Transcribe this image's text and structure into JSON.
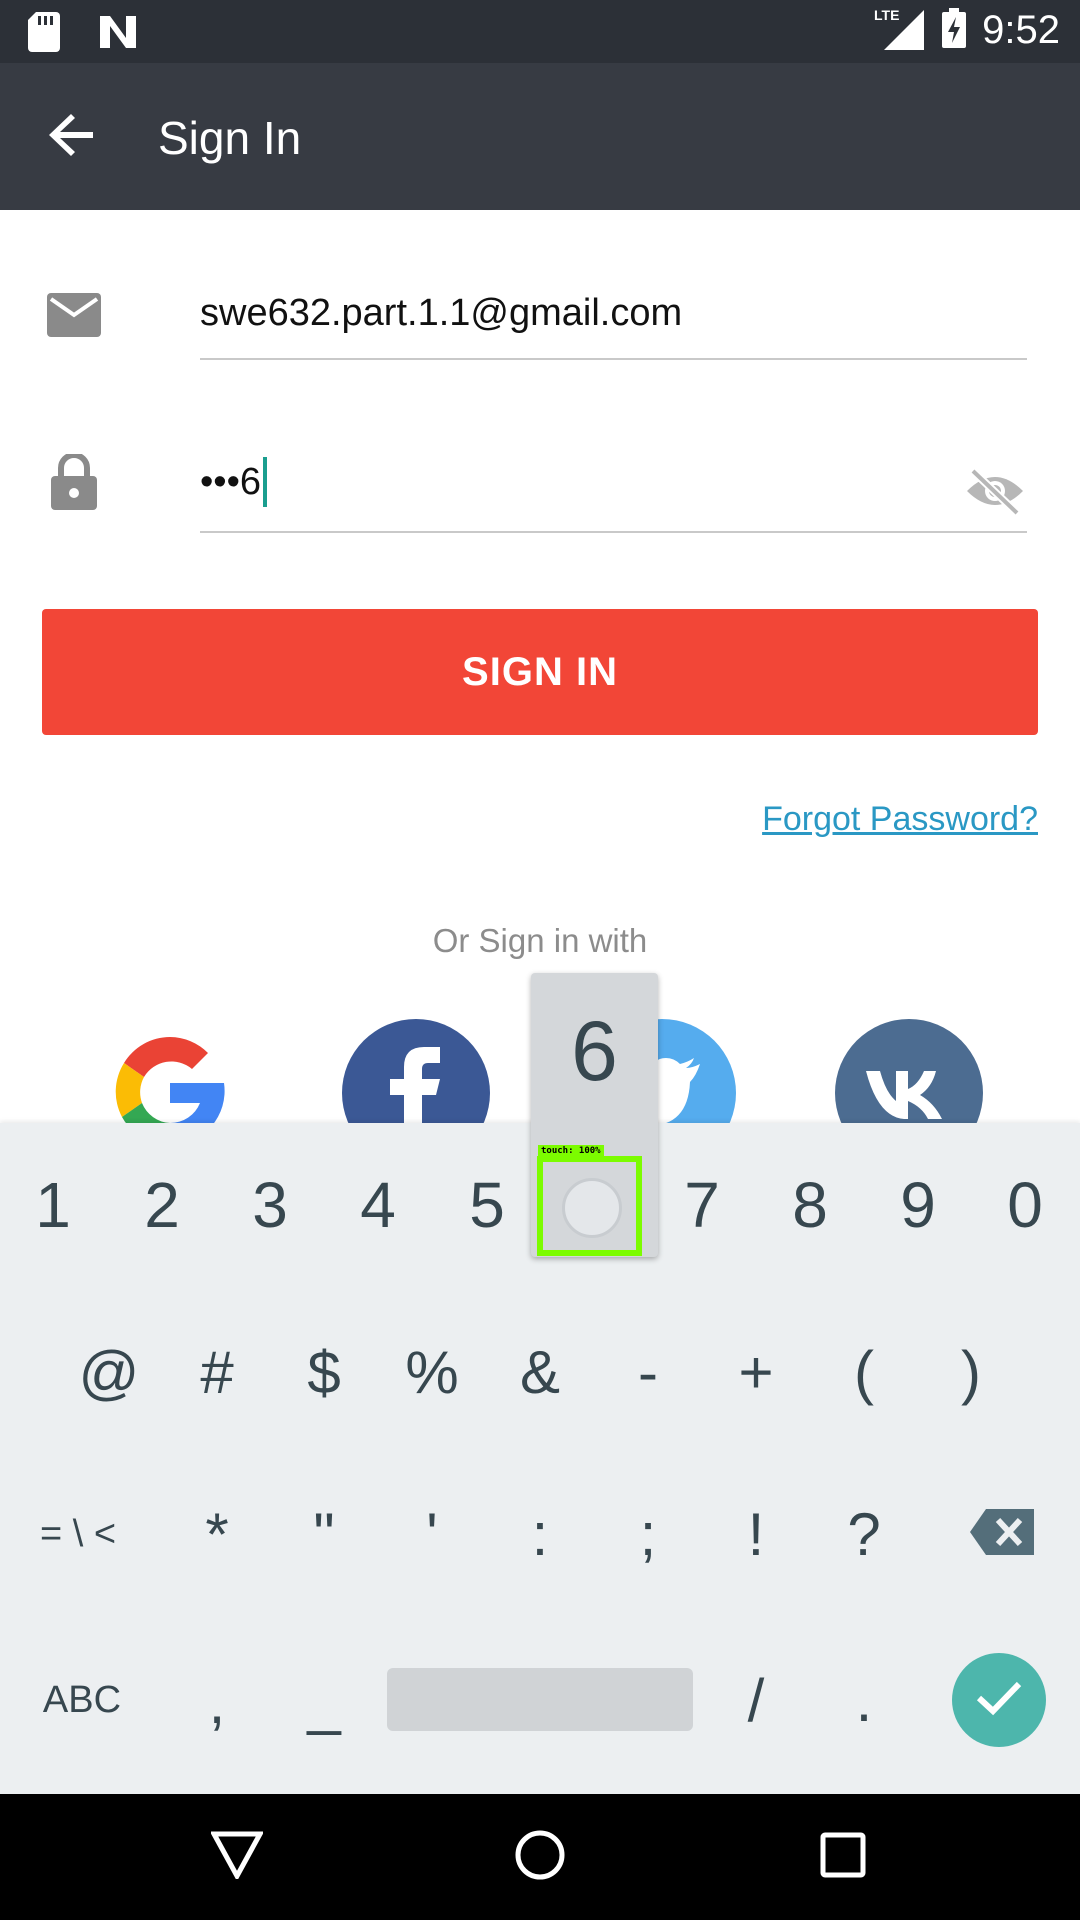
{
  "status_bar": {
    "time": "9:52",
    "network": "LTE",
    "left_icons": [
      "sd-card-icon",
      "n-notification-icon"
    ],
    "right_icons": [
      "lte-signal-icon",
      "battery-charging-icon"
    ]
  },
  "app_bar": {
    "title": "Sign In",
    "back_icon": "arrow-back-icon"
  },
  "form": {
    "email": {
      "icon": "mail-icon",
      "value": "swe632.part.1.1@gmail.com"
    },
    "password": {
      "icon": "lock-icon",
      "value": "•••6",
      "toggle_icon": "eye-off-icon"
    },
    "sign_in_label": "SIGN IN",
    "forgot_password_label": "Forgot Password?",
    "or_sign_in_with": "Or Sign in with"
  },
  "social": [
    {
      "name": "google",
      "icon": "google-icon",
      "color": "#ffffff"
    },
    {
      "name": "facebook",
      "icon": "facebook-icon",
      "color": "#3b5895"
    },
    {
      "name": "twitter",
      "icon": "twitter-icon",
      "color": "#55acee"
    },
    {
      "name": "vk",
      "icon": "vk-icon",
      "color": "#4c6c91"
    }
  ],
  "keyboard": {
    "row1": [
      "1",
      "2",
      "3",
      "4",
      "5",
      "7",
      "8",
      "9",
      "0"
    ],
    "row2": [
      "@",
      "#",
      "$",
      "%",
      "&",
      "-",
      "+",
      "(",
      ")"
    ],
    "row3": [
      "= \\ <",
      "*",
      "\"",
      "'",
      ":",
      ";",
      "!",
      "?"
    ],
    "row4": {
      "abc": "ABC",
      "comma": ",",
      "underscore": "_",
      "slash": "/",
      "period": "."
    },
    "backspace_icon": "backspace-icon",
    "done_icon": "check-icon",
    "preview_key": "6",
    "touch_label": "touch: 100%"
  },
  "nav_bar": {
    "back": "triangle-back-icon",
    "home": "circle-home-icon",
    "recents": "square-recents-icon"
  },
  "colors": {
    "status_bar": "#2c3037",
    "app_bar": "#373b43",
    "sign_in_button": "#f24637",
    "link": "#2a98c4",
    "caret": "#1a9e8f",
    "keyboard_bg": "#eceff1",
    "done_key": "#4db6ac",
    "touch_highlight": "#7cfc00"
  }
}
